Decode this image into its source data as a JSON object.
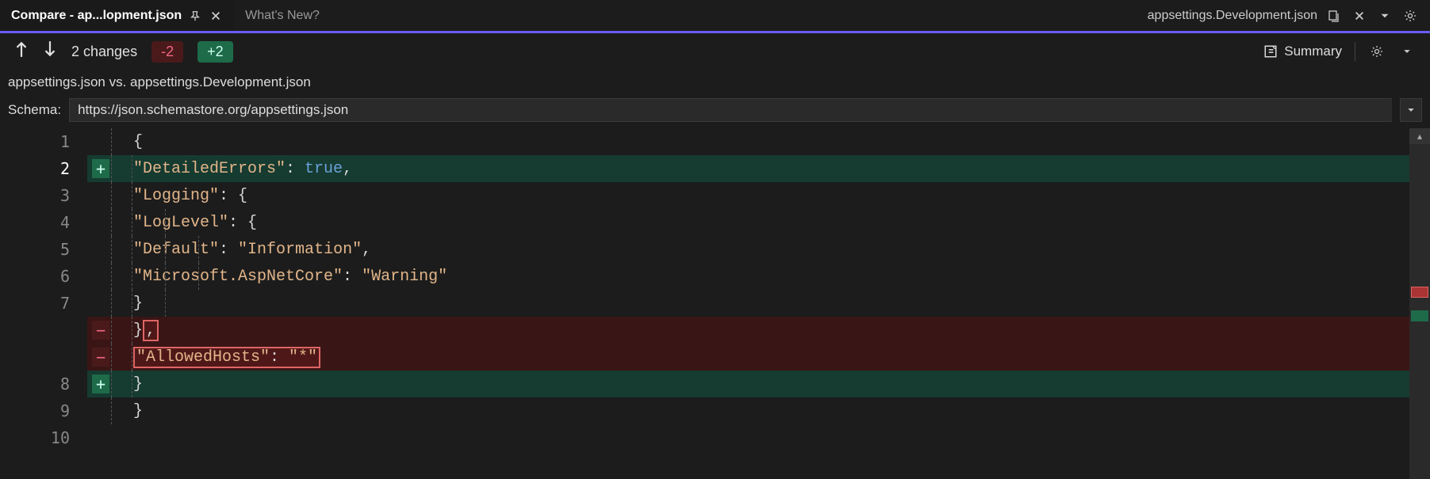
{
  "tabs": {
    "active_title": "Compare - ap...lopment.json",
    "inactive_title": "What's New?",
    "right_filename": "appsettings.Development.json"
  },
  "toolbar": {
    "changes_label": "2 changes",
    "minus_badge": "-2",
    "plus_badge": "+2",
    "summary_label": "Summary"
  },
  "compare_header": "appsettings.json vs. appsettings.Development.json",
  "schema": {
    "label": "Schema:",
    "value": "https://json.schemastore.org/appsettings.json"
  },
  "gutter": [
    "1",
    "2",
    "3",
    "4",
    "5",
    "6",
    "7",
    "",
    "",
    "8",
    "9",
    "10"
  ],
  "code": {
    "l1": "{",
    "l2_key": "\"DetailedErrors\"",
    "l2_val": "true",
    "l3_key": "\"Logging\"",
    "l4_key": "\"LogLevel\"",
    "l5_key": "\"Default\"",
    "l5_val": "\"Information\"",
    "l6_key": "\"Microsoft.AspNetCore\"",
    "l6_val": "\"Warning\"",
    "l7": "}",
    "l8a": "}",
    "l8b": ",",
    "l9_key": "\"AllowedHosts\"",
    "l9_val": "\"*\"",
    "l10": "}",
    "l11": "}"
  }
}
